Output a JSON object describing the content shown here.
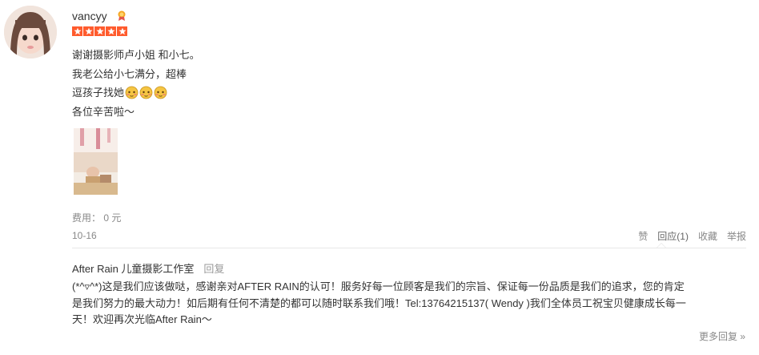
{
  "review": {
    "username": "vancyy",
    "rating_stars": 5,
    "lines": [
      "谢谢摄影师卢小姐 和小七。",
      "我老公给小七满分，超棒",
      "逗孩子找她",
      "各位辛苦啦～"
    ],
    "cost_label": "费用： 0 元",
    "date": "10-16"
  },
  "actions": {
    "like": "赞",
    "reply": "回应(1)",
    "favorite": "收藏",
    "report": "举报"
  },
  "merchant_reply": {
    "author": "After Rain 儿童摄影工作室",
    "reply_link": "回复",
    "lines": [
      "(*^▿^*)这是我们应该做哒，感谢亲对AFTER RAIN的认可！服务好每一位顾客是我们的宗旨、保证每一份品质是我们的追求，您的肯定",
      "是我们努力的最大动力！如后期有任何不清楚的都可以随时联系我们哦！Tel:13764215137( Wendy )我们全体员工祝宝贝健康成长每一",
      "天！欢迎再次光临After Rain～"
    ]
  },
  "more_replies": "更多回复 »"
}
